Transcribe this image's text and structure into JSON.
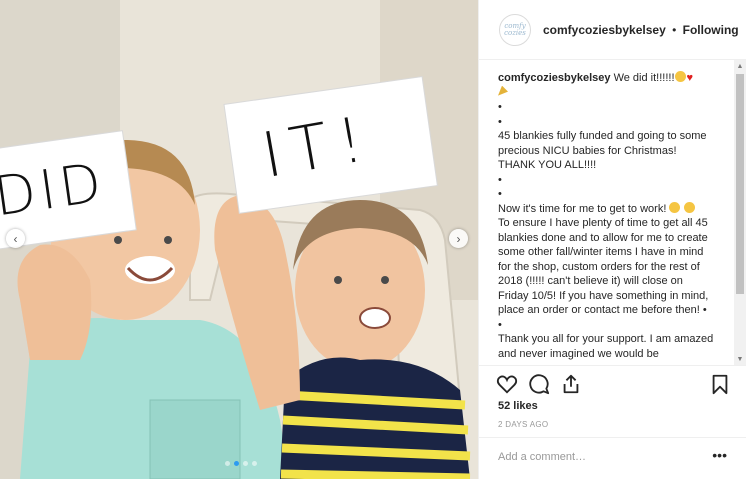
{
  "post": {
    "username": "comfycoziesbykelsey",
    "separator": "•",
    "follow_state": "Following",
    "avatar_text": "comfy cozies",
    "photo": {
      "sign_left_text": "DID",
      "sign_right_text": "IT!",
      "carousel_dots": 4,
      "active_dot": 2
    }
  },
  "icons": {
    "prev": "chevron-left-icon",
    "next": "chevron-right-icon",
    "like": "heart-outline-icon",
    "comment": "comment-bubble-icon",
    "share": "share-icon",
    "save": "bookmark-icon",
    "more": "more-options-icon"
  },
  "caption": {
    "user": "comfycoziesbykelsey",
    "first_line": "We did it!!!!!!",
    "bullet": "•",
    "p1": "45 blankies fully funded and going to some precious NICU babies for Christmas! THANK YOU ALL!!!!",
    "p2": "Now it's time for me to get to work!",
    "p3": "To ensure I have plenty of time to get all 45 blankies done and to allow for me to create some other fall/winter items I have in mind for the shop, custom orders for the rest of 2018 (!!!!! can't believe it) will close on Friday 10/5! If you have something in mind, place an order or contact me before then! •",
    "p4": "Thank you all for your support. I am amazed and never imagined we would be"
  },
  "stats": {
    "likes": "52 likes",
    "date": "2 DAYS AGO"
  },
  "comment_box": {
    "placeholder": "Add a comment…",
    "more": "•••"
  },
  "colors": {
    "accent_dot": "#2d9bf0",
    "text": "#262626",
    "muted": "#999999",
    "heart": "#e02020"
  }
}
